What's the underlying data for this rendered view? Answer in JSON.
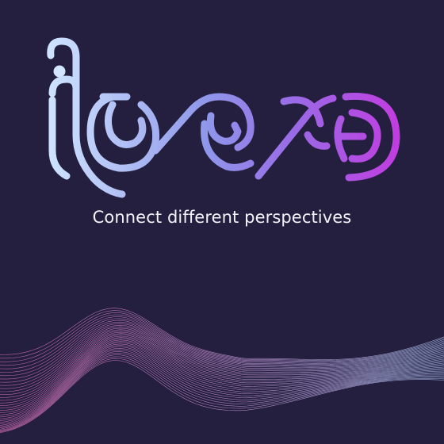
{
  "brand": {
    "logo_text": "ibeec",
    "tagline": "Connect different perspectives"
  },
  "colors": {
    "background": "#241f3f",
    "gradient_start": "#cfe4ff",
    "gradient_mid": "#7f8ae6",
    "gradient_end": "#c23ce0",
    "tagline": "#f4f2fb",
    "wave_pink": "#d86fb8",
    "wave_blue": "#a9c3f0"
  },
  "icons": [
    "brand-logo",
    "wave-decoration"
  ]
}
